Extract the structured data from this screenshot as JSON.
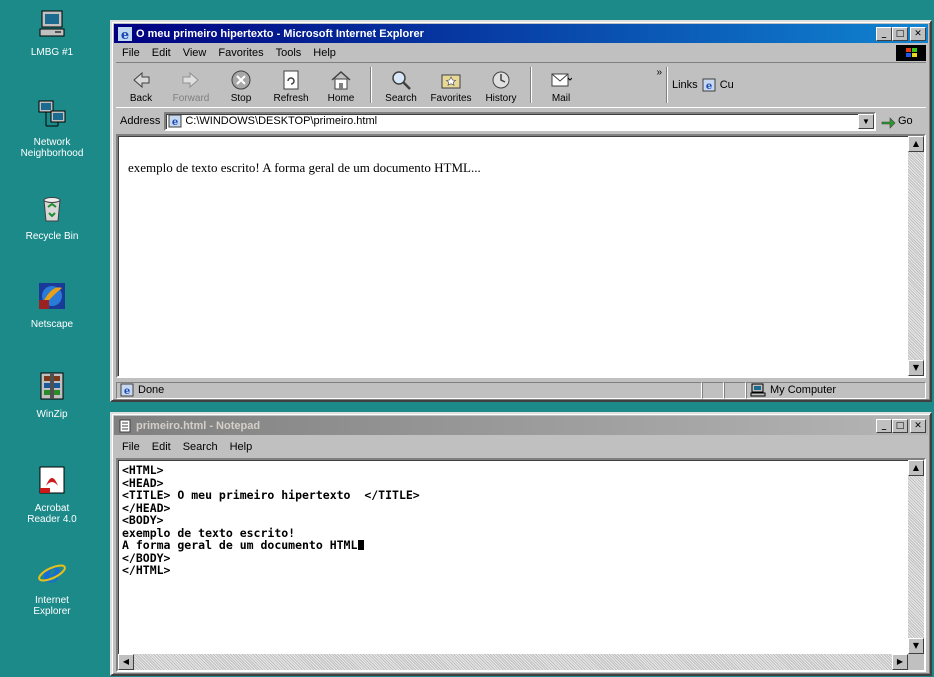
{
  "desktop_icons": [
    {
      "name": "my-computer-icon",
      "label": "LMBG #1"
    },
    {
      "name": "network-neighborhood-icon",
      "label": "Network\nNeighborhood"
    },
    {
      "name": "recycle-bin-icon",
      "label": "Recycle Bin"
    },
    {
      "name": "netscape-icon",
      "label": "Netscape"
    },
    {
      "name": "winzip-icon",
      "label": "WinZip"
    },
    {
      "name": "acrobat-reader-icon",
      "label": "Acrobat\nReader 4.0"
    },
    {
      "name": "internet-explorer-icon",
      "label": "Internet\nExplorer"
    }
  ],
  "ie": {
    "title": "O meu primeiro hipertexto - Microsoft Internet Explorer",
    "menu": [
      "File",
      "Edit",
      "View",
      "Favorites",
      "Tools",
      "Help"
    ],
    "toolbar": {
      "back": "Back",
      "forward": "Forward",
      "stop": "Stop",
      "refresh": "Refresh",
      "home": "Home",
      "search": "Search",
      "favorites": "Favorites",
      "history": "History",
      "mail": "Mail",
      "links": "Links",
      "links_item": "Cu"
    },
    "address_label": "Address",
    "address_value": "C:\\WINDOWS\\DESKTOP\\primeiro.html",
    "go_label": "Go",
    "page_text": "exemplo de texto escrito! A forma geral de um documento HTML...",
    "status_text": "Done",
    "status_zone": "My Computer"
  },
  "notepad": {
    "title": "primeiro.html - Notepad",
    "menu": [
      "File",
      "Edit",
      "Search",
      "Help"
    ],
    "lines": [
      "<HTML>",
      "<HEAD>",
      "<TITLE> O meu primeiro hipertexto  </TITLE>",
      "</HEAD>",
      "<BODY>",
      "exemplo de texto escrito!",
      "A forma geral de um documento HTML",
      "</BODY>",
      "</HTML>"
    ]
  },
  "colors": {
    "desktop": "#1d8a8a",
    "titlebar_active": "#000080",
    "titlebar_inactive": "#808080",
    "window_face": "#c0c0c0"
  }
}
